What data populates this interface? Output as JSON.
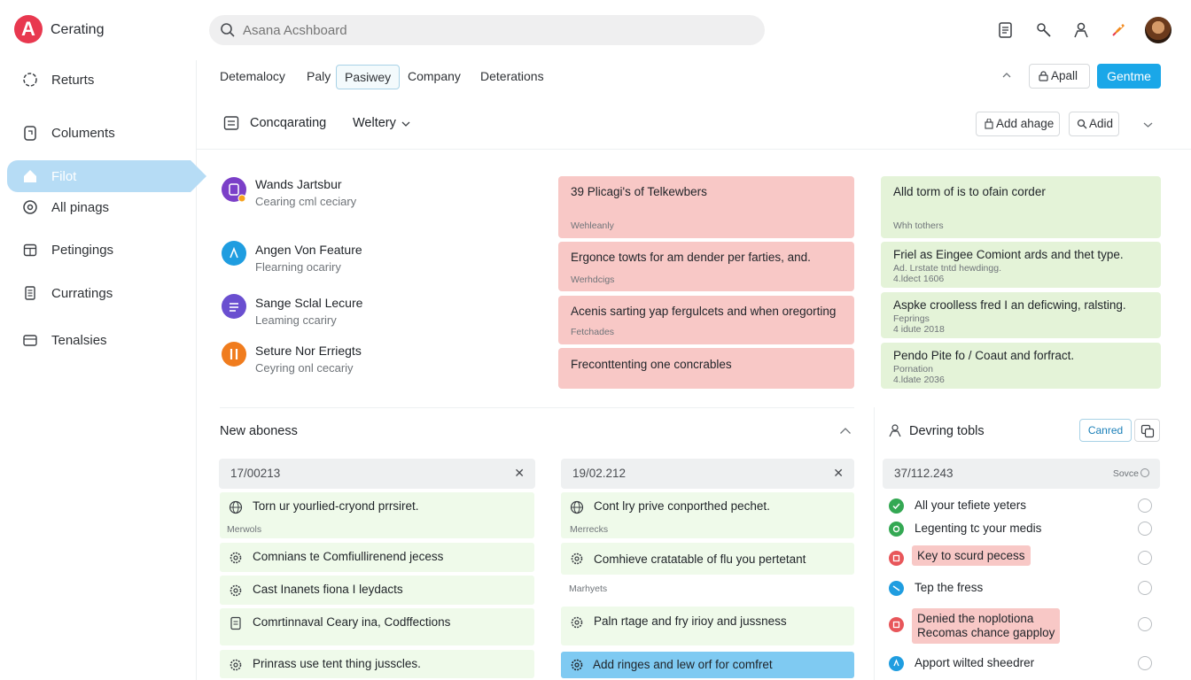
{
  "app": {
    "logo": "A",
    "title": "Cerating"
  },
  "search": {
    "placeholder": "Asana Acshboard"
  },
  "sidebar": {
    "items": [
      {
        "label": "Returts",
        "icon": "refresh-icon"
      },
      {
        "label": "Columents",
        "icon": "clipboard-icon"
      },
      {
        "label": "Filot",
        "icon": "home-icon",
        "active": true
      },
      {
        "label": "All pinags",
        "icon": "target-icon"
      },
      {
        "label": "Petingings",
        "icon": "calendar-icon"
      },
      {
        "label": "Curratings",
        "icon": "document-icon"
      },
      {
        "label": "Tenalsies",
        "icon": "folder-icon"
      }
    ]
  },
  "tabs": [
    "Detemalocy",
    "Paly",
    "Pasiwey",
    "Company",
    "Deterations"
  ],
  "header_actions": {
    "appall": "Apall",
    "primary": "Gentme"
  },
  "section_bar": {
    "title": "Concqarating",
    "dropdown": "Weltery",
    "add_image": "Add ahage",
    "add": "Adid"
  },
  "people": [
    {
      "name": "Wands Jartsbur",
      "sub": "Cearing cml ceciary",
      "color": "#7b3fc8"
    },
    {
      "name": "Angen Von Feature",
      "sub": "Flearning ocariry",
      "color": "#1f9de0"
    },
    {
      "name": "Sange Sclal Lecure",
      "sub": "Leaming ccariry",
      "color": "#6a4fd0"
    },
    {
      "name": "Seture Nor Erriegts",
      "sub": "Ceyring onl cecariy",
      "color": "#f07c1e"
    }
  ],
  "red_cards": [
    {
      "title": "39 Plicagi's of Telkewbers",
      "sub": "Wehleanly"
    },
    {
      "title": "Ergonce towts for am dender per farties, and.",
      "sub": "Werhdcigs"
    },
    {
      "title": "Acenis sarting yap fergulcets and when oregorting",
      "sub": "Fetchades"
    },
    {
      "title": "Freconttenting one concrables",
      "sub": ""
    }
  ],
  "green_cards": [
    {
      "title": "Alld torm of is to ofain corder",
      "sub": "Whh tothers"
    },
    {
      "title": "Friel as Eingee Comiont ards and thet type.",
      "sub": "Ad. Lrstate tntd hewdingg.\n4.ldect 1606"
    },
    {
      "title": "Aspke croolless fred I an deficwing, ralsting.",
      "sub": "Feprings\n4 idute 2018"
    },
    {
      "title": "Pendo Pite fo / Coaut and forfract.",
      "sub": "Pornation\n4.ldate 2036"
    }
  ],
  "new_section": {
    "title": "New aboness"
  },
  "col1": {
    "head": "17/00213",
    "rows": [
      {
        "label": "Torn ur yourlied-cryond prrsiret.",
        "icon": "globe-icon"
      },
      {
        "label": "Comnians te Comfiullirenend jecess",
        "icon": "gear-icon"
      },
      {
        "label": "Cast Inanets fiona I leydacts",
        "icon": "gear-icon"
      },
      {
        "label": "Comrtinnaval Ceary ina, Codffections",
        "icon": "document-icon"
      },
      {
        "label": "Prinrass use tent thing jusscles.",
        "icon": "gear-icon"
      }
    ],
    "sub": "Merwols"
  },
  "col2": {
    "head": "19/02.212",
    "rows": [
      {
        "label": "Cont lry prive conporthed pechet.",
        "icon": "globe-icon"
      },
      {
        "label": "Comhieve cratatable of flu you pertetant",
        "icon": "gear-icon"
      },
      {
        "label": "Paln rtage and fry irioy and jussness",
        "icon": "gear-icon"
      },
      {
        "label": "Add ringes and lew orf for comfret",
        "icon": "gear-icon"
      }
    ],
    "sub1": "Merrecks",
    "sub2": "Marhyets"
  },
  "col3": {
    "title": "Devring tobls",
    "button": "Canred",
    "head": "37/112.243",
    "save": "Sovce",
    "tasks": [
      {
        "label": "All your tefiete yeters",
        "color": "#34a853",
        "hl": false
      },
      {
        "label": "Legenting tc your medis",
        "color": "#34a853",
        "hl": false
      },
      {
        "label": "Key to scurd pecess",
        "color": "#e8565a",
        "hl": true
      },
      {
        "label": "Tep the fress",
        "color": "#1f9de0",
        "hl": false
      },
      {
        "label": "Denied the noplotiona\nRecomas chance gapploy",
        "color": "#e8565a",
        "hl": true
      },
      {
        "label": "Apport wilted sheedrer",
        "color": "#1f9de0",
        "hl": false
      }
    ]
  }
}
